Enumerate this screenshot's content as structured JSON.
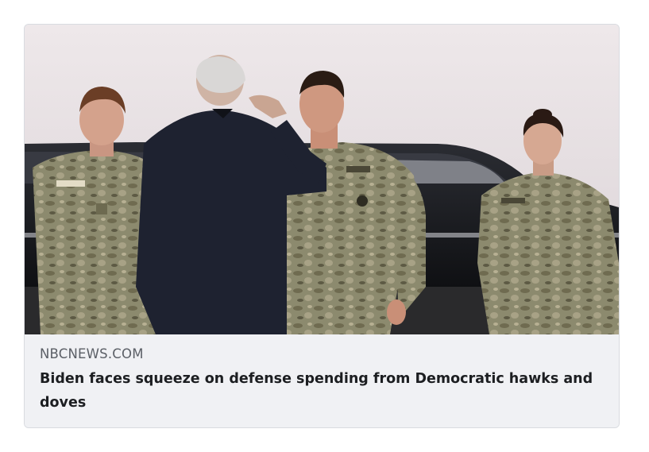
{
  "link_preview": {
    "domain": "NBCNEWS.COM",
    "headline": "Biden faces squeeze on defense spending from Democratic hawks and doves",
    "image": {
      "subject": "man-in-suit-saluting-soldiers"
    }
  },
  "colors": {
    "card_bg": "#f0f1f4",
    "border": "#d9dbe0",
    "domain_text": "#5b5f66",
    "headline_text": "#1c1e21",
    "sky": "#e6e0e2",
    "camo": "#8a8468",
    "suit": "#1e2230"
  }
}
